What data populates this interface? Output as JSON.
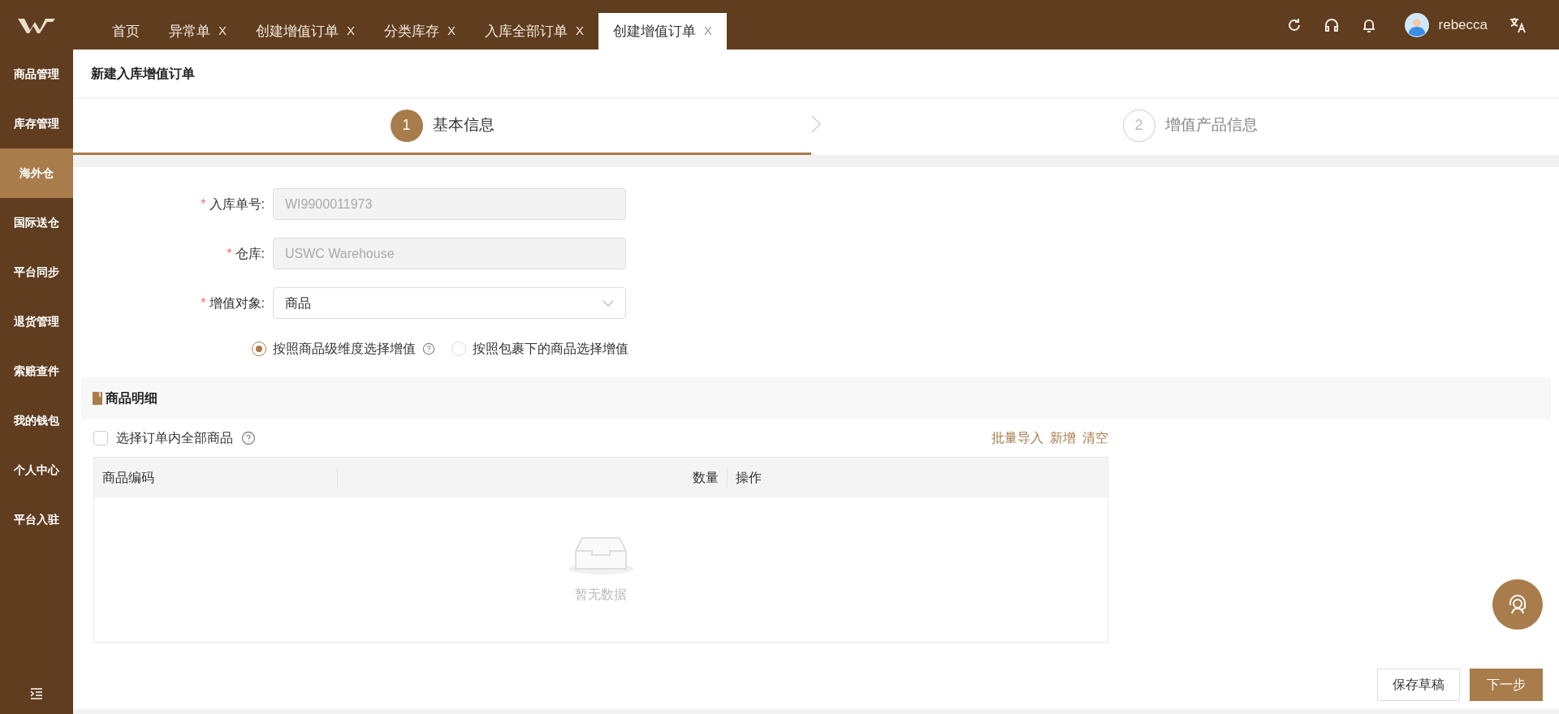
{
  "top_bar": {
    "tabs": [
      {
        "label": "首页",
        "selected": false
      },
      {
        "label": "异常单",
        "close": "X",
        "selected": false
      },
      {
        "label": "创建增值订单",
        "close": "X",
        "selected": false
      },
      {
        "label": "分类库存",
        "close": "X",
        "selected": false
      },
      {
        "label": "入库全部订单",
        "close": "X",
        "selected": false
      },
      {
        "label": "创建增值订单",
        "close": "X",
        "selected": true
      }
    ],
    "user": "rebecca"
  },
  "sidebar": {
    "items": [
      {
        "label": "商品管理",
        "selected": false
      },
      {
        "label": "库存管理",
        "selected": false
      },
      {
        "label": "海外仓",
        "selected": true
      },
      {
        "label": "国际送仓",
        "selected": false
      },
      {
        "label": "平台同步",
        "selected": false
      },
      {
        "label": "退货管理",
        "selected": false
      },
      {
        "label": "索赔查件",
        "selected": false
      },
      {
        "label": "我的钱包",
        "selected": false
      },
      {
        "label": "个人中心",
        "selected": false
      },
      {
        "label": "平台入驻",
        "selected": false
      }
    ]
  },
  "page_title": "新建入库增值订单",
  "steps": [
    {
      "number": "1",
      "label": "基本信息",
      "selected": true
    },
    {
      "number": "2",
      "label": "增值产品信息",
      "selected": false
    }
  ],
  "form": {
    "fields": [
      {
        "kind": "readonly",
        "label": "入库单号:",
        "required_mark": "*",
        "value": "WI9900011973"
      },
      {
        "kind": "readonly",
        "label": "仓库:",
        "required_mark": "*",
        "value": "USWC Warehouse"
      },
      {
        "kind": "select",
        "label": "增值对象:",
        "required_mark": "*",
        "value": "商品"
      }
    ],
    "radios": [
      {
        "label": "按照商品级维度选择增值",
        "help": true,
        "selected": true
      },
      {
        "label": "按照包裹下的商品选择增值",
        "help": false,
        "selected": false
      }
    ]
  },
  "section": {
    "title": "商品明细",
    "select_all": {
      "label": "选择订单内全部商品",
      "checked": false
    },
    "links": [
      "批量导入",
      "新增",
      "清空"
    ],
    "table": {
      "columns": [
        "商品编码",
        "数量",
        "操作"
      ],
      "empty_text": "暂无数据"
    }
  },
  "buttons": [
    {
      "label": "保存草稿",
      "kind": "secondary"
    },
    {
      "label": "下一步",
      "kind": "primary"
    }
  ]
}
